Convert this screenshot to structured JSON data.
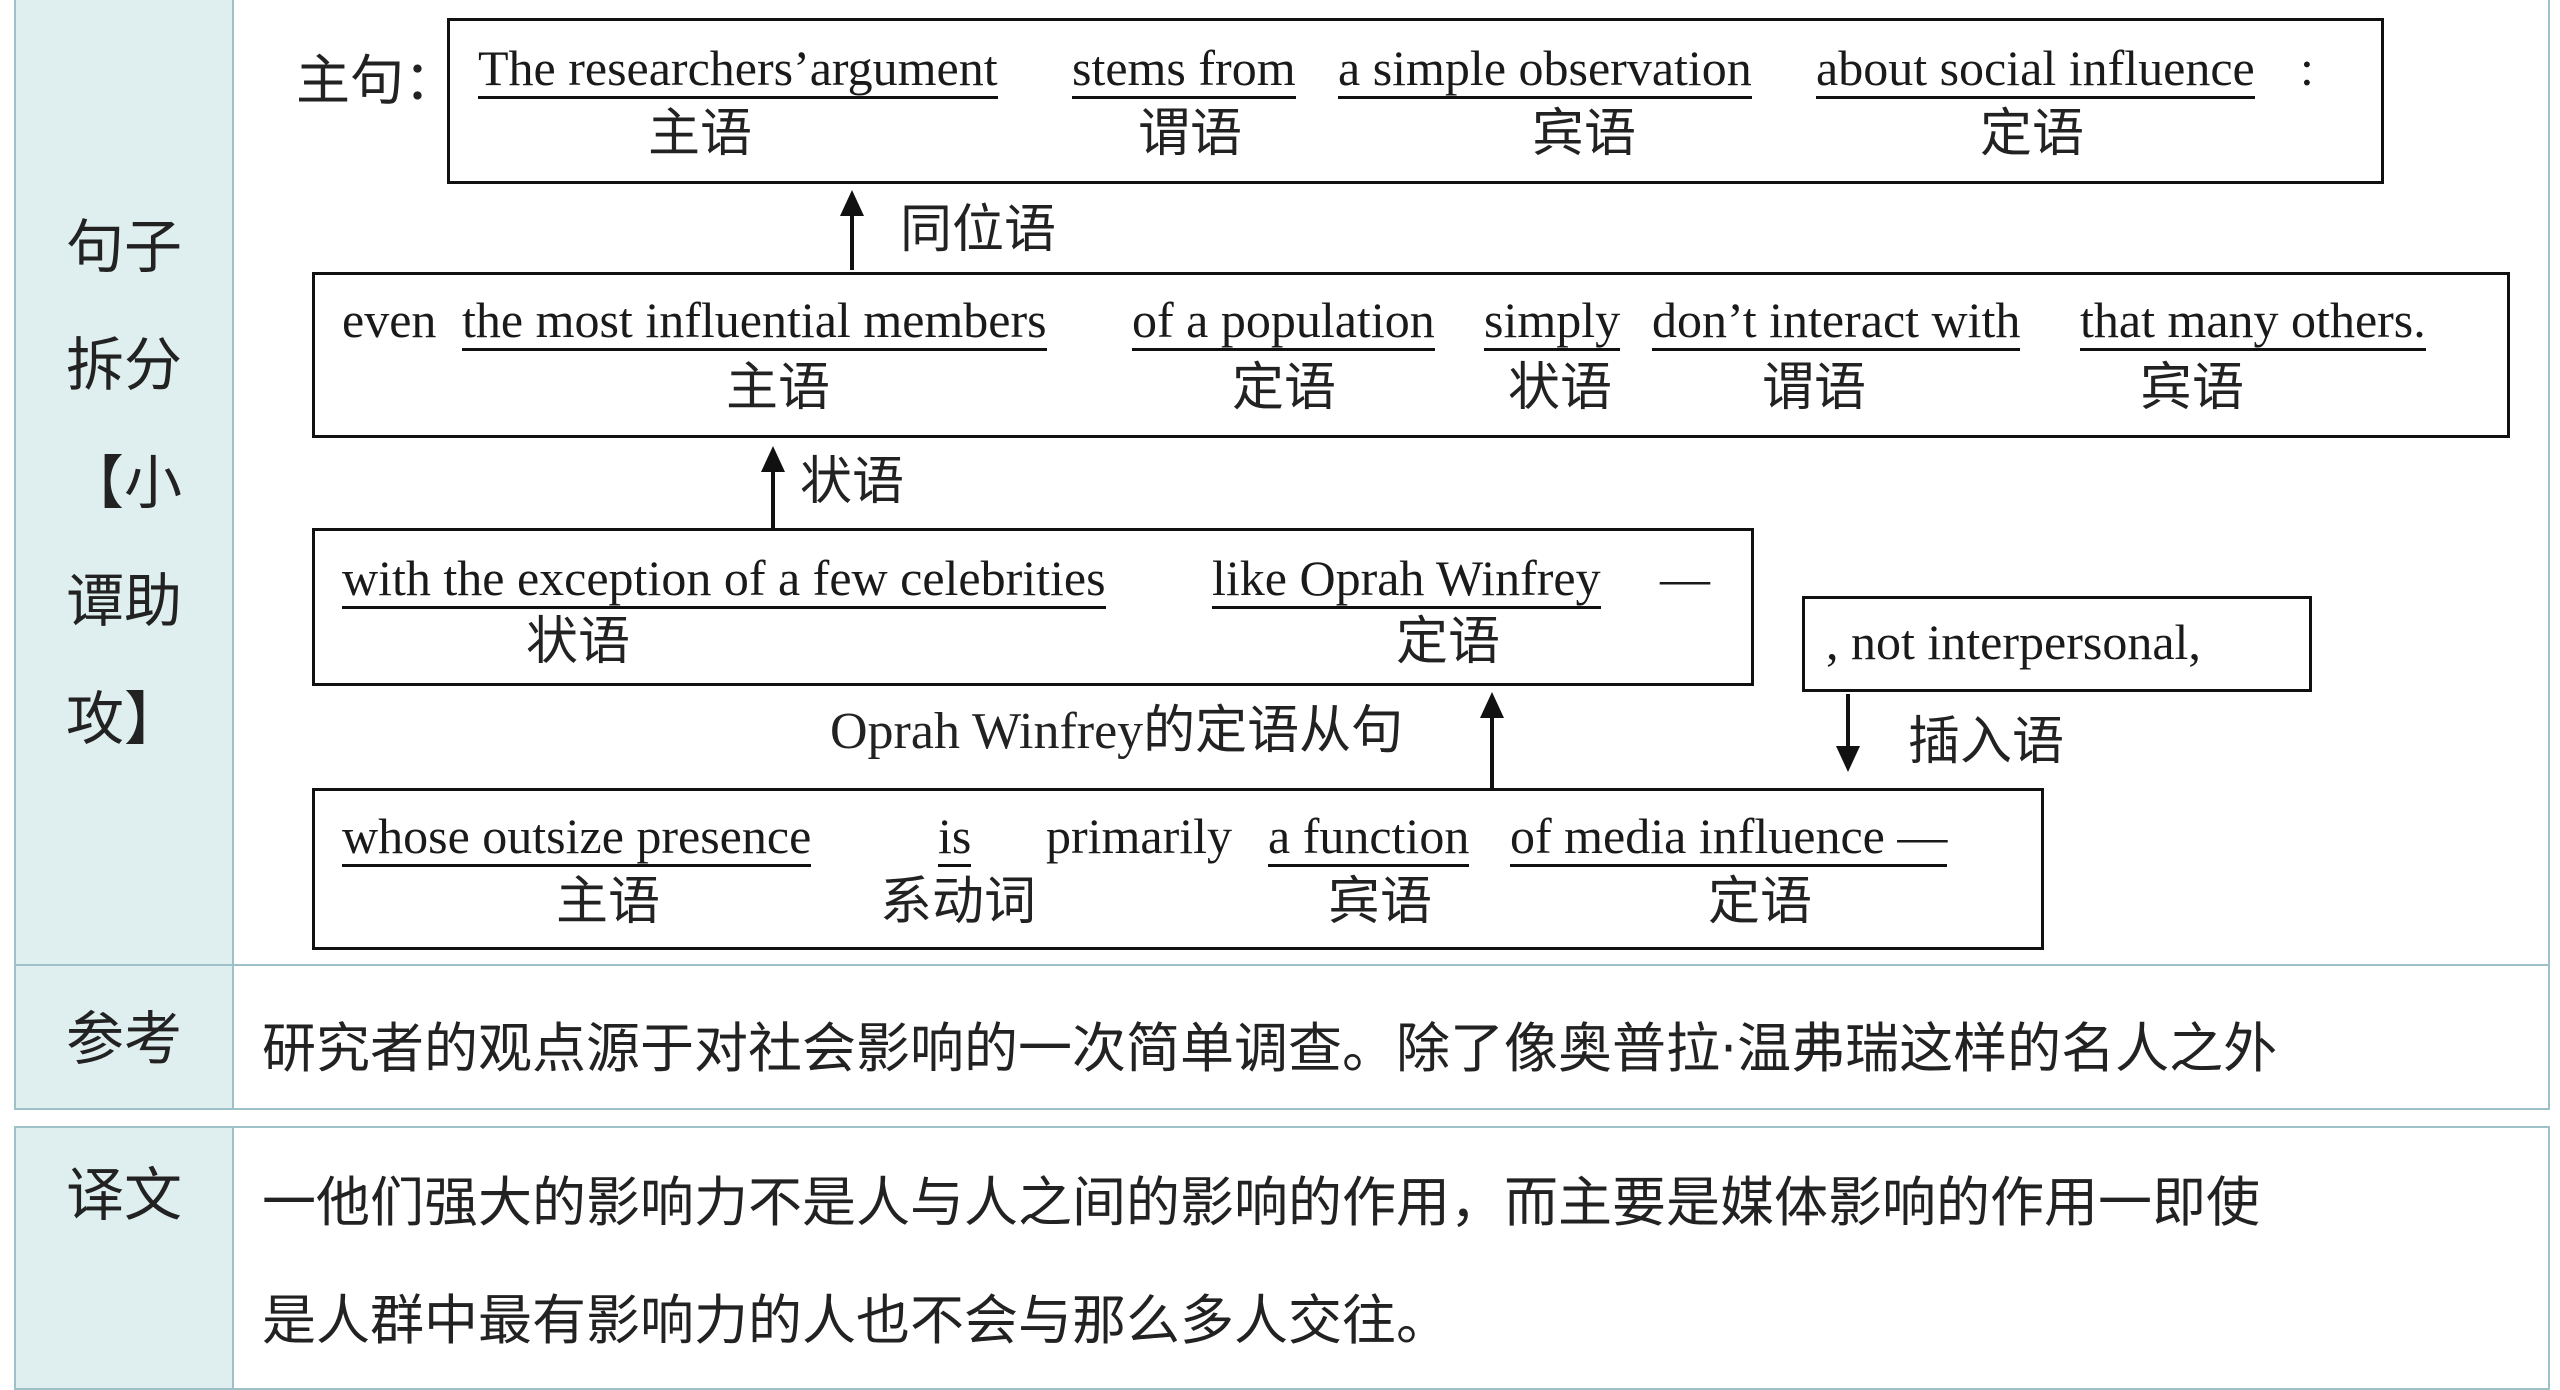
{
  "labels": {
    "split": "句子\n拆分\n【小\n谭助\n攻】",
    "ref": "参考",
    "trans": "译文"
  },
  "main_prefix": "主句：",
  "box1": {
    "subject": "The researchers’argument",
    "verb": "stems from",
    "object": "a simple observation",
    "attr": "about social influence",
    "colon": ":",
    "roles": {
      "subject": "主语",
      "verb": "谓语",
      "object": "宾语",
      "attr": "定语"
    }
  },
  "link_appositive": "同位语",
  "box2": {
    "lead": "even",
    "subject": "the most influential members",
    "attr": "of a population",
    "adv": "simply",
    "verb": "don’t interact with",
    "object": "that many others.",
    "roles": {
      "subject": "主语",
      "attr": "定语",
      "adv": "状语",
      "verb": "谓语",
      "object": "宾语"
    }
  },
  "link_adverbial": "状语",
  "box3": {
    "adv": "with the exception of a few celebrities",
    "attr": "like Oprah Winfrey",
    "dash": "—",
    "roles": {
      "adv": "状语",
      "attr": "定语"
    }
  },
  "box_paren": {
    "text": ", not interpersonal,"
  },
  "link_relative": "Oprah Winfrey的定语从句",
  "link_parenthesis": "插入语",
  "box4": {
    "subject": "whose outsize presence",
    "linking": "is",
    "adverb": "primarily",
    "object": "a function",
    "attr": "of media influence —",
    "roles": {
      "subject": "主语",
      "linking": "系动词",
      "object": "宾语",
      "attr": "定语"
    }
  },
  "translation": {
    "line1": "研究者的观点源于对社会影响的一次简单调查。除了像奥普拉·温弗瑞这样的名人之外",
    "line2": "一他们强大的影响力不是人与人之间的影响的作用，而主要是媒体影响的作用一即使",
    "line3": "是人群中最有影响力的人也不会与那么多人交往。"
  }
}
